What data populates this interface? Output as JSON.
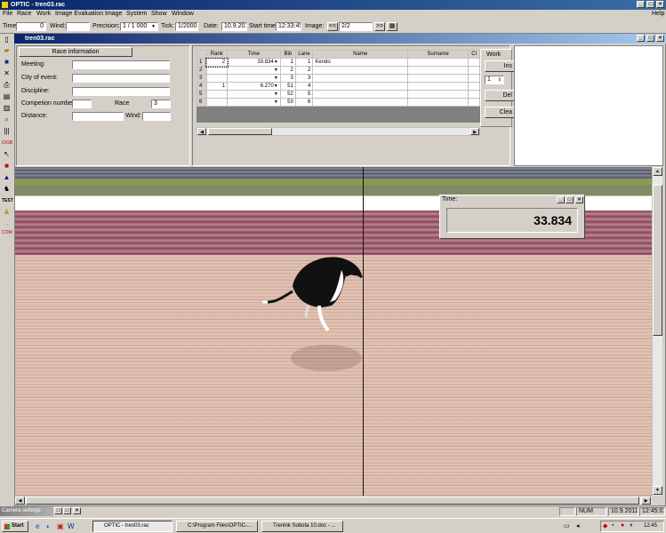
{
  "app": {
    "title": "OPTIC - tren03.rac"
  },
  "menu": [
    "File",
    "Race",
    "Work",
    "Image Evaluation",
    "Image",
    "System",
    "Show",
    "Window"
  ],
  "menu_help": "Help",
  "toolbar": {
    "time_label": "Time:",
    "time_value": "0",
    "wind_label": "Wind:",
    "wind_value": "",
    "precision_label": "Precision:",
    "precision_value": "1 / 1 000",
    "tick_label": "Tick:",
    "tick_value": "1/2000",
    "date_label": "Date:",
    "date_value": "10.9.201",
    "start_label": "Start time",
    "start_value": "12:33:45",
    "image_label": "Image:",
    "prev": "<<",
    "image_value": "2/2",
    "next": ">>"
  },
  "child": {
    "title": "tren03.rac"
  },
  "race_info": {
    "header": "Race information",
    "meeting": "Meeting:",
    "city": "City of event:",
    "discipline": "Discipline:",
    "comp_number": "Competion number:",
    "race_label": "Race",
    "race_value": "3",
    "distance": "Distance:",
    "wind": "Wind:"
  },
  "results": {
    "columns": [
      "Rank",
      "Time",
      "Bib",
      "Lane",
      "Name",
      "Surname",
      "Cl"
    ],
    "rows": [
      {
        "n": "1",
        "rank": "2",
        "time": "33.834",
        "bib": "1",
        "lane": "1",
        "name": "Kendo",
        "surname": ""
      },
      {
        "n": "2",
        "rank": "",
        "time": "",
        "bib": "2",
        "lane": "2",
        "name": "",
        "surname": ""
      },
      {
        "n": "3",
        "rank": "",
        "time": "",
        "bib": "3",
        "lane": "3",
        "name": "",
        "surname": ""
      },
      {
        "n": "4",
        "rank": "1",
        "time": "6.270",
        "bib": "51",
        "lane": "4",
        "name": "",
        "surname": ""
      },
      {
        "n": "5",
        "rank": "",
        "time": "",
        "bib": "52",
        "lane": "5",
        "name": "",
        "surname": ""
      },
      {
        "n": "6",
        "rank": "",
        "time": "",
        "bib": "53",
        "lane": "6",
        "name": "",
        "surname": ""
      }
    ]
  },
  "work": {
    "header": "Work",
    "insert": "Ins",
    "spin": "1",
    "delete": "Del",
    "clear": "Clea"
  },
  "time_window": {
    "title": "Time:",
    "value": "33.834"
  },
  "camera_settings": "Camera settings",
  "status": {
    "num": "NUM",
    "date": "10.9.2011",
    "time": "12:45:01"
  },
  "taskbar": {
    "start": "Start",
    "tasks": [
      "OPTIC - tren03.rac",
      "C:\\Program Files\\OPTIC-...",
      "Trenink Sobota 10.doc - ..."
    ],
    "clock": "12:45"
  },
  "colors": {
    "title_blue": "#0a246a",
    "child_title_light": "#a6caf0",
    "face": "#d4d0c8"
  }
}
